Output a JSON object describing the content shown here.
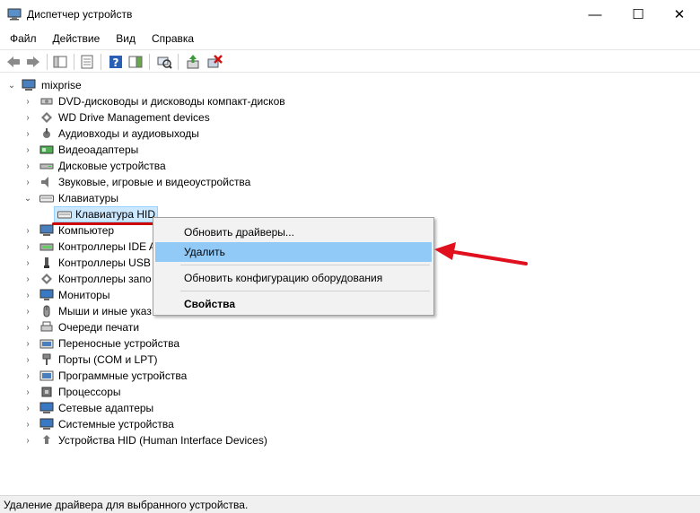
{
  "window": {
    "title": "Диспетчер устройств",
    "minimize_glyph": "—",
    "maximize_glyph": "☐",
    "close_glyph": "✕"
  },
  "menu": [
    "Файл",
    "Действие",
    "Вид",
    "Справка"
  ],
  "tree": {
    "root": "mixprise",
    "items": [
      {
        "label": "DVD-дисководы и дисководы компакт-дисков",
        "icon": "dvd-drive-icon",
        "expanded": false
      },
      {
        "label": "WD Drive Management devices",
        "icon": "wd-device-icon",
        "expanded": false
      },
      {
        "label": "Аудиовходы и аудиовыходы",
        "icon": "audio-icon",
        "expanded": false
      },
      {
        "label": "Видеоадаптеры",
        "icon": "display-adapter-icon",
        "expanded": false
      },
      {
        "label": "Дисковые устройства",
        "icon": "disk-drive-icon",
        "expanded": false
      },
      {
        "label": "Звуковые, игровые и видеоустройства",
        "icon": "sound-icon",
        "expanded": false
      },
      {
        "label": "Клавиатуры",
        "icon": "keyboard-icon",
        "expanded": true
      },
      {
        "label": "Компьютер",
        "icon": "computer-icon",
        "expanded": false
      },
      {
        "label": "Контроллеры IDE A",
        "icon": "ide-controller-icon",
        "expanded": false
      },
      {
        "label": "Контроллеры USB",
        "icon": "usb-icon",
        "expanded": false
      },
      {
        "label": "Контроллеры запо",
        "icon": "storage-controller-icon",
        "expanded": false
      },
      {
        "label": "Мониторы",
        "icon": "monitor-icon",
        "expanded": false
      },
      {
        "label": "Мыши и иные указ",
        "icon": "mouse-icon",
        "expanded": false
      },
      {
        "label": "Очереди печати",
        "icon": "print-queue-icon",
        "expanded": false
      },
      {
        "label": "Переносные устройства",
        "icon": "portable-device-icon",
        "expanded": false
      },
      {
        "label": "Порты (COM и LPT)",
        "icon": "port-icon",
        "expanded": false
      },
      {
        "label": "Программные устройства",
        "icon": "software-device-icon",
        "expanded": false
      },
      {
        "label": "Процессоры",
        "icon": "processor-icon",
        "expanded": false
      },
      {
        "label": "Сетевые адаптеры",
        "icon": "network-adapter-icon",
        "expanded": false
      },
      {
        "label": "Системные устройства",
        "icon": "system-device-icon",
        "expanded": false
      },
      {
        "label": "Устройства HID (Human Interface Devices)",
        "icon": "hid-icon",
        "expanded": false
      }
    ],
    "selected_child": "Клавиатура HID"
  },
  "context_menu": {
    "update": "Обновить драйверы...",
    "uninstall": "Удалить",
    "scan": "Обновить конфигурацию оборудования",
    "properties": "Свойства"
  },
  "status": "Удаление драйвера для выбранного устройства.",
  "colors": {
    "selection": "#cce8ff",
    "menu_hover": "#91c9f7",
    "annotation_red": "#e0101e"
  }
}
